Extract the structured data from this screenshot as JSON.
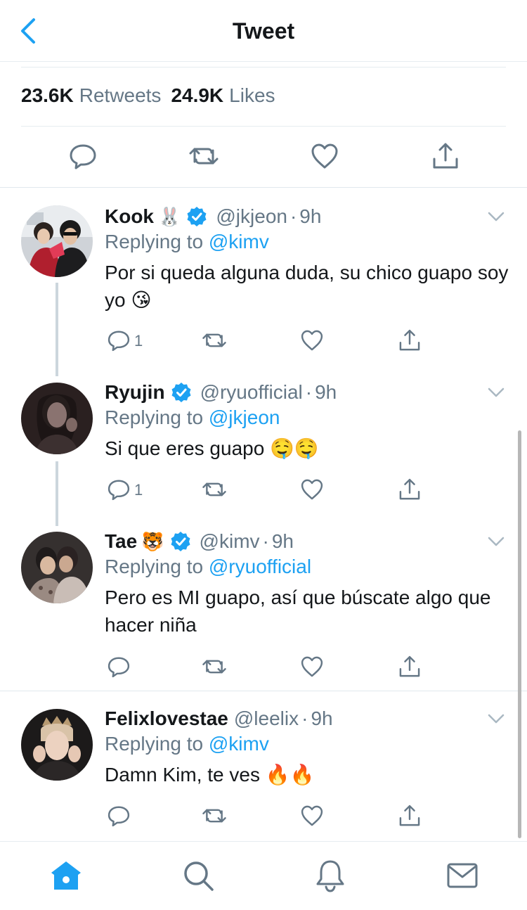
{
  "header": {
    "title": "Tweet",
    "back_icon": "chevron-left-icon"
  },
  "stats": {
    "retweets_count": "23.6K",
    "retweets_label": "Retweets",
    "likes_count": "24.9K",
    "likes_label": "Likes"
  },
  "colors": {
    "accent": "#1da1f2",
    "secondary_text": "#657786",
    "divider": "#e6ecf0"
  },
  "tweets": [
    {
      "name": "Kook",
      "emoji": "🐰",
      "verified": true,
      "handle": "@jkjeon",
      "dot": "·",
      "time": "9h",
      "replying_prefix": "Replying to",
      "replying_to": "@kimv",
      "text": "Por si queda alguna duda, su chico guapo soy yo 😘",
      "reply_count": "1"
    },
    {
      "name": "Ryujin",
      "emoji": "",
      "verified": true,
      "handle": "@ryuofficial",
      "dot": "·",
      "time": "9h",
      "replying_prefix": "Replying to",
      "replying_to": "@jkjeon",
      "text": "Si que eres guapo 🤤🤤",
      "reply_count": "1"
    },
    {
      "name": "Tae",
      "emoji": "🐯",
      "verified": true,
      "handle": "@kimv",
      "dot": "·",
      "time": "9h",
      "replying_prefix": "Replying to",
      "replying_to": "@ryuofficial",
      "text": "Pero es MI guapo, así que búscate algo que hacer niña",
      "reply_count": ""
    },
    {
      "name": "Felixlovestae",
      "emoji": "",
      "verified": false,
      "handle": "@leelix",
      "dot": "·",
      "time": "9h",
      "replying_prefix": "Replying to",
      "replying_to": "@kimv",
      "text": "Damn Kim, te ves 🔥🔥",
      "reply_count": ""
    }
  ],
  "tabbar": {
    "items": [
      "home-icon",
      "search-icon",
      "notifications-icon",
      "messages-icon"
    ],
    "active": "home-icon"
  }
}
